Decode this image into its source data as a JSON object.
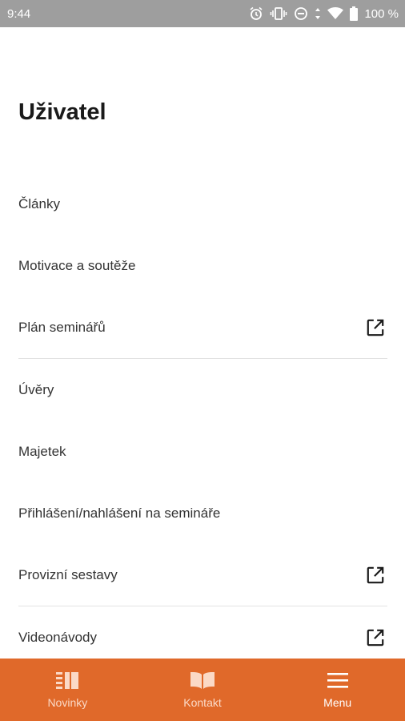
{
  "status_bar": {
    "time": "9:44",
    "battery_text": "100 %",
    "icons": [
      "alarm-icon",
      "vibrate-icon",
      "do-not-disturb-icon",
      "data-arrows-icon",
      "wifi-icon",
      "battery-icon"
    ]
  },
  "page": {
    "title": "Uživatel"
  },
  "menu": {
    "items": [
      {
        "label": "Články",
        "external": false
      },
      {
        "label": "Motivace a soutěže",
        "external": false
      },
      {
        "label": "Plán seminářů",
        "external": true
      },
      {
        "label": "Úvěry",
        "external": false
      },
      {
        "label": "Majetek",
        "external": false
      },
      {
        "label": "Přihlášení/nahlášení na semináře",
        "external": false
      },
      {
        "label": "Provizní sestavy",
        "external": true
      },
      {
        "label": "Videonávody",
        "external": true
      }
    ],
    "external_icon": "open-in-new-icon"
  },
  "bottom_nav": {
    "tabs": [
      {
        "label": "Novinky",
        "icon": "news-icon",
        "active": false
      },
      {
        "label": "Kontakt",
        "icon": "book-icon",
        "active": false
      },
      {
        "label": "Menu",
        "icon": "hamburger-menu-icon",
        "active": true
      }
    ]
  },
  "colors": {
    "accent": "#e0692a",
    "status_bar": "#9e9e9e"
  }
}
